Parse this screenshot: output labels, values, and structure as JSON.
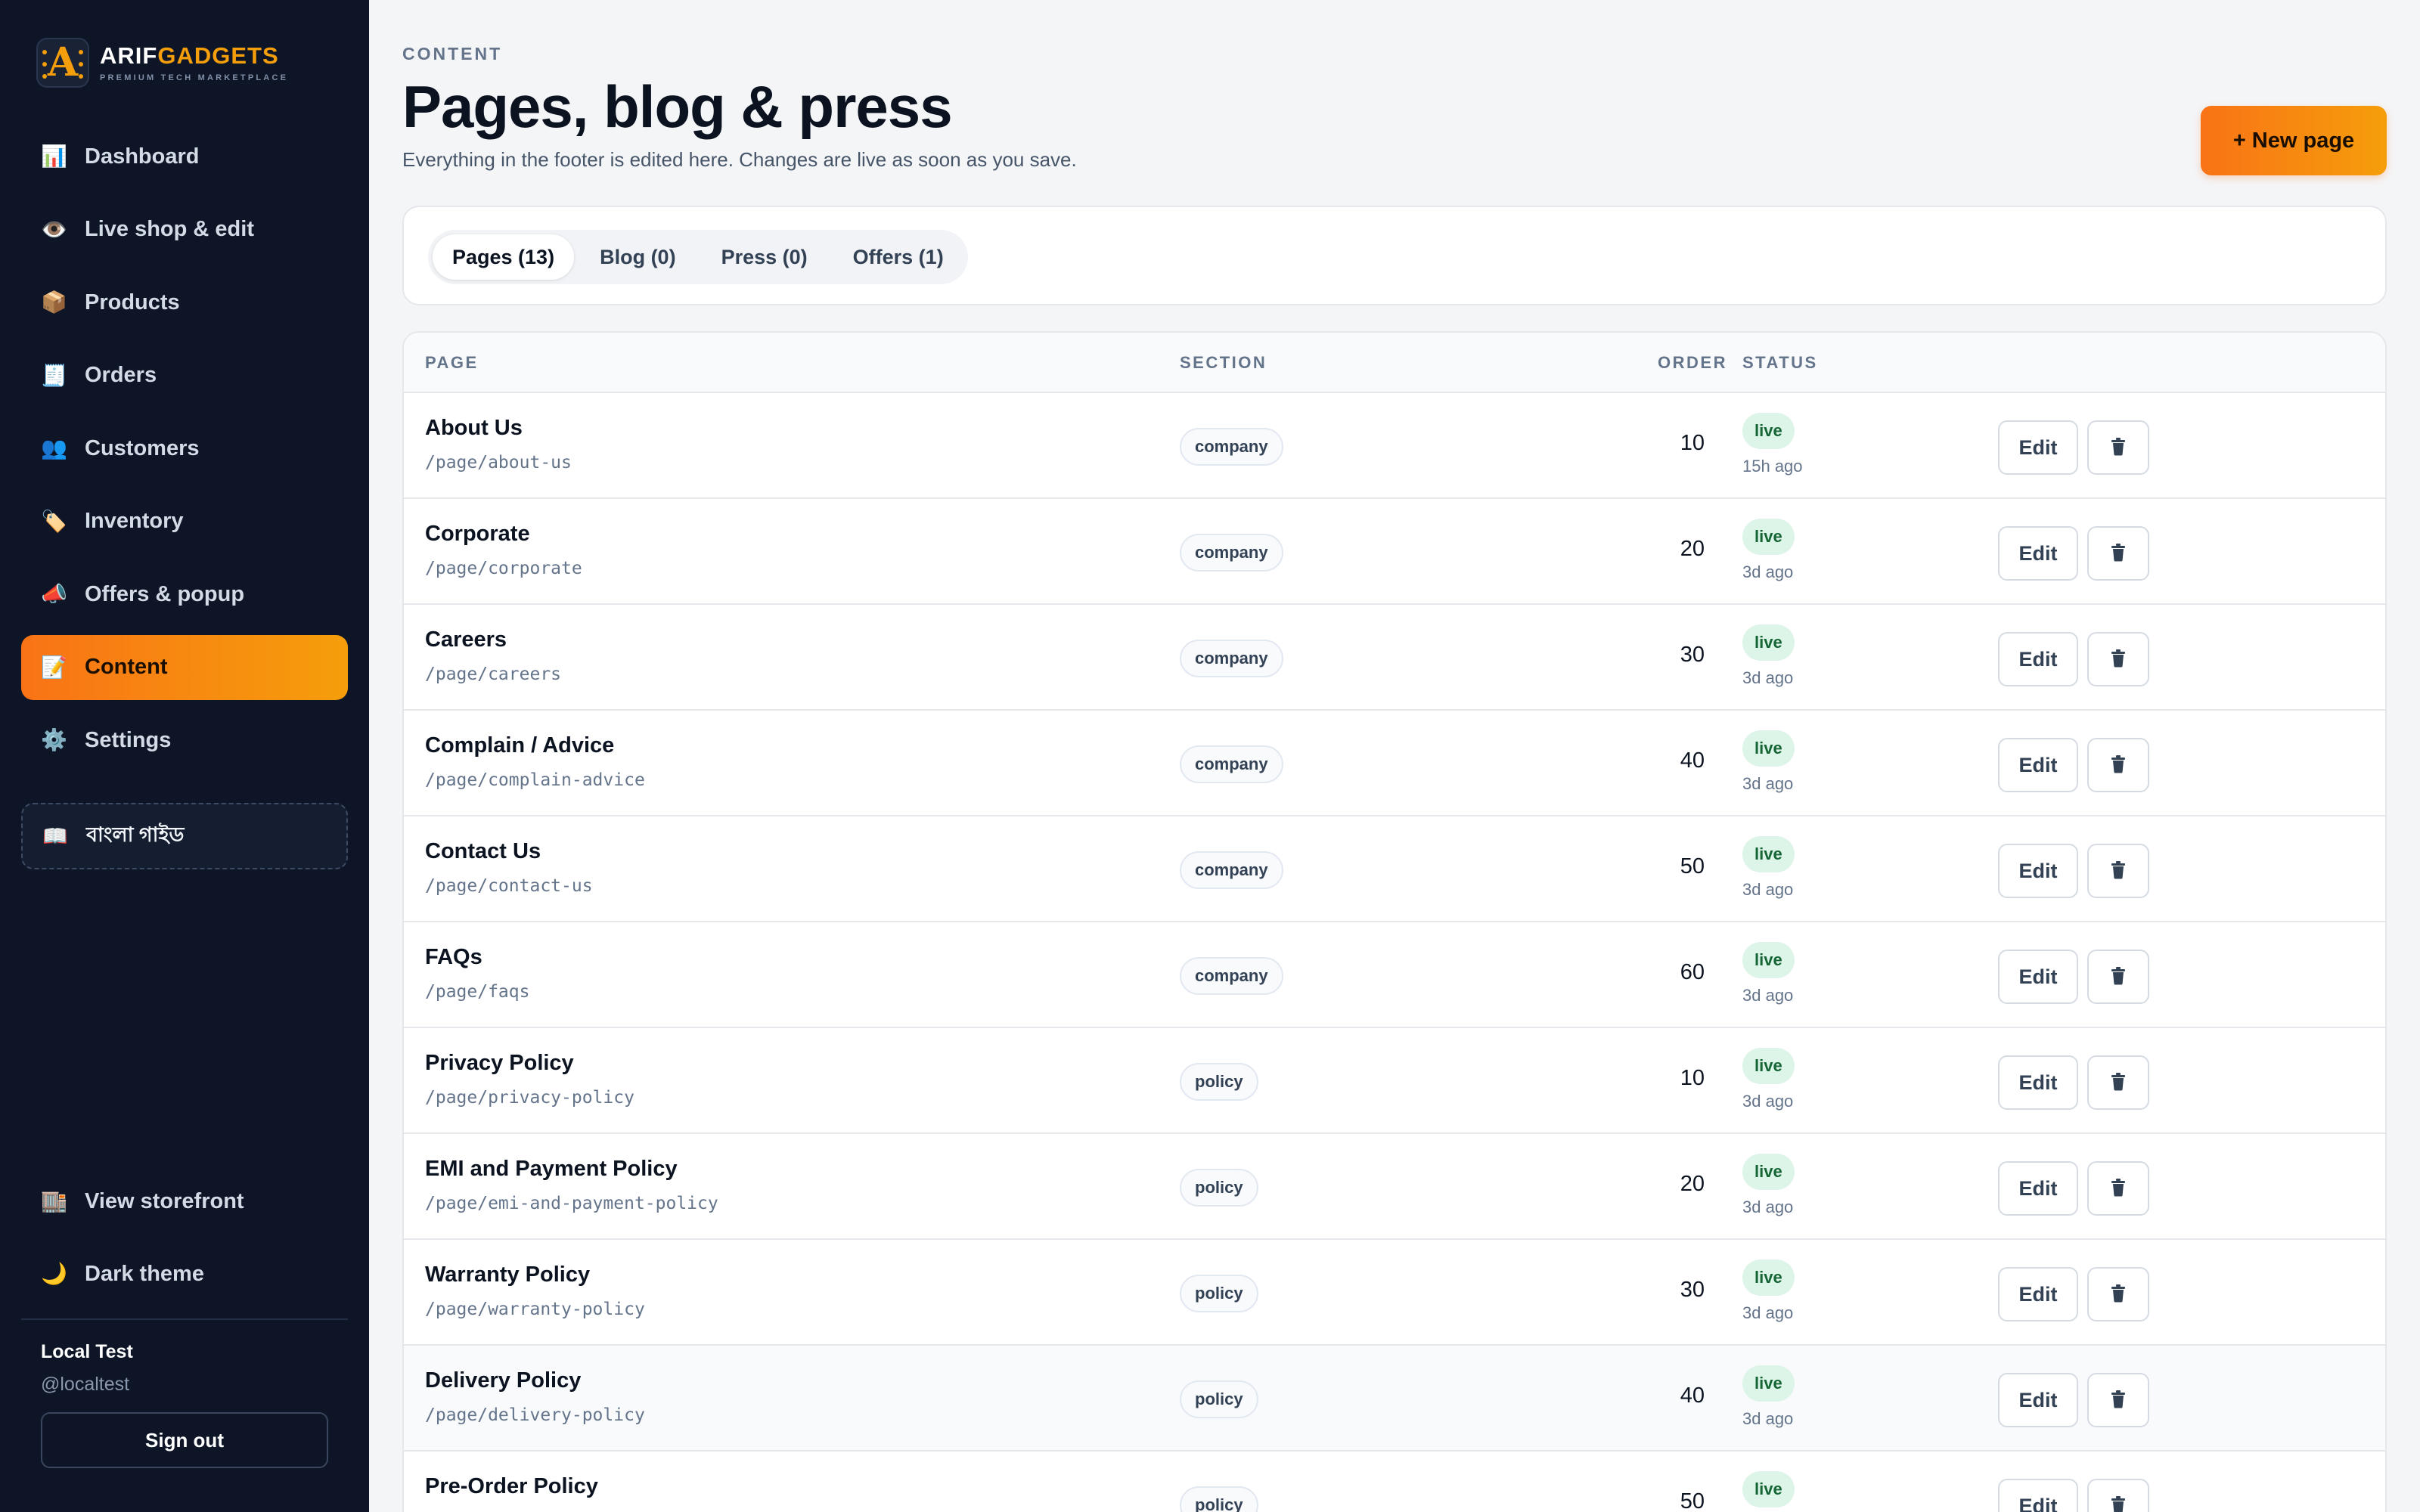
{
  "brand": {
    "logo_letter": "A",
    "name_part1": "ARIF",
    "name_part2": "GADGETS",
    "tagline": "PREMIUM TECH MARKETPLACE",
    "accent_color": "#f59e0b"
  },
  "sidebar": {
    "items": [
      {
        "icon": "📊",
        "icon_name": "bar-chart-icon",
        "label": "Dashboard",
        "active": false
      },
      {
        "icon": "👁️",
        "icon_name": "eye-icon",
        "label": "Live shop & edit",
        "active": false
      },
      {
        "icon": "📦",
        "icon_name": "package-icon",
        "label": "Products",
        "active": false
      },
      {
        "icon": "🧾",
        "icon_name": "receipt-icon",
        "label": "Orders",
        "active": false
      },
      {
        "icon": "👥",
        "icon_name": "users-icon",
        "label": "Customers",
        "active": false
      },
      {
        "icon": "🏷️",
        "icon_name": "tag-icon",
        "label": "Inventory",
        "active": false
      },
      {
        "icon": "📣",
        "icon_name": "megaphone-icon",
        "label": "Offers & popup",
        "active": false
      },
      {
        "icon": "📝",
        "icon_name": "memo-icon",
        "label": "Content",
        "active": true
      },
      {
        "icon": "⚙️",
        "icon_name": "gear-icon",
        "label": "Settings",
        "active": false
      }
    ],
    "guide": {
      "icon": "📖",
      "label": "বাংলা গাইড"
    },
    "bottom": [
      {
        "icon": "🏬",
        "icon_name": "storefront-icon",
        "label": "View storefront"
      },
      {
        "icon": "🌙",
        "icon_name": "moon-icon",
        "label": "Dark theme"
      }
    ],
    "user": {
      "name": "Local Test",
      "handle": "@localtest",
      "signout_label": "Sign out"
    }
  },
  "header": {
    "eyebrow": "CONTENT",
    "title": "Pages, blog & press",
    "subtitle": "Everything in the footer is edited here. Changes are live as soon as you save.",
    "new_button": "+ New page"
  },
  "tabs": [
    {
      "label": "Pages (13)",
      "active": true
    },
    {
      "label": "Blog (0)",
      "active": false
    },
    {
      "label": "Press (0)",
      "active": false
    },
    {
      "label": "Offers (1)",
      "active": false
    }
  ],
  "table": {
    "columns": {
      "page": "PAGE",
      "section": "SECTION",
      "order": "ORDER",
      "status": "STATUS"
    },
    "edit_label": "Edit",
    "rows": [
      {
        "title": "About Us",
        "slug": "/page/about-us",
        "section": "company",
        "order": "10",
        "status": "live",
        "updated": "15h ago"
      },
      {
        "title": "Corporate",
        "slug": "/page/corporate",
        "section": "company",
        "order": "20",
        "status": "live",
        "updated": "3d ago"
      },
      {
        "title": "Careers",
        "slug": "/page/careers",
        "section": "company",
        "order": "30",
        "status": "live",
        "updated": "3d ago"
      },
      {
        "title": "Complain / Advice",
        "slug": "/page/complain-advice",
        "section": "company",
        "order": "40",
        "status": "live",
        "updated": "3d ago"
      },
      {
        "title": "Contact Us",
        "slug": "/page/contact-us",
        "section": "company",
        "order": "50",
        "status": "live",
        "updated": "3d ago"
      },
      {
        "title": "FAQs",
        "slug": "/page/faqs",
        "section": "company",
        "order": "60",
        "status": "live",
        "updated": "3d ago"
      },
      {
        "title": "Privacy Policy",
        "slug": "/page/privacy-policy",
        "section": "policy",
        "order": "10",
        "status": "live",
        "updated": "3d ago"
      },
      {
        "title": "EMI and Payment Policy",
        "slug": "/page/emi-and-payment-policy",
        "section": "policy",
        "order": "20",
        "status": "live",
        "updated": "3d ago"
      },
      {
        "title": "Warranty Policy",
        "slug": "/page/warranty-policy",
        "section": "policy",
        "order": "30",
        "status": "live",
        "updated": "3d ago"
      },
      {
        "title": "Delivery Policy",
        "slug": "/page/delivery-policy",
        "section": "policy",
        "order": "40",
        "status": "live",
        "updated": "3d ago"
      },
      {
        "title": "Pre-Order Policy",
        "slug": "",
        "section": "policy",
        "order": "50",
        "status": "live",
        "updated": ""
      }
    ]
  }
}
